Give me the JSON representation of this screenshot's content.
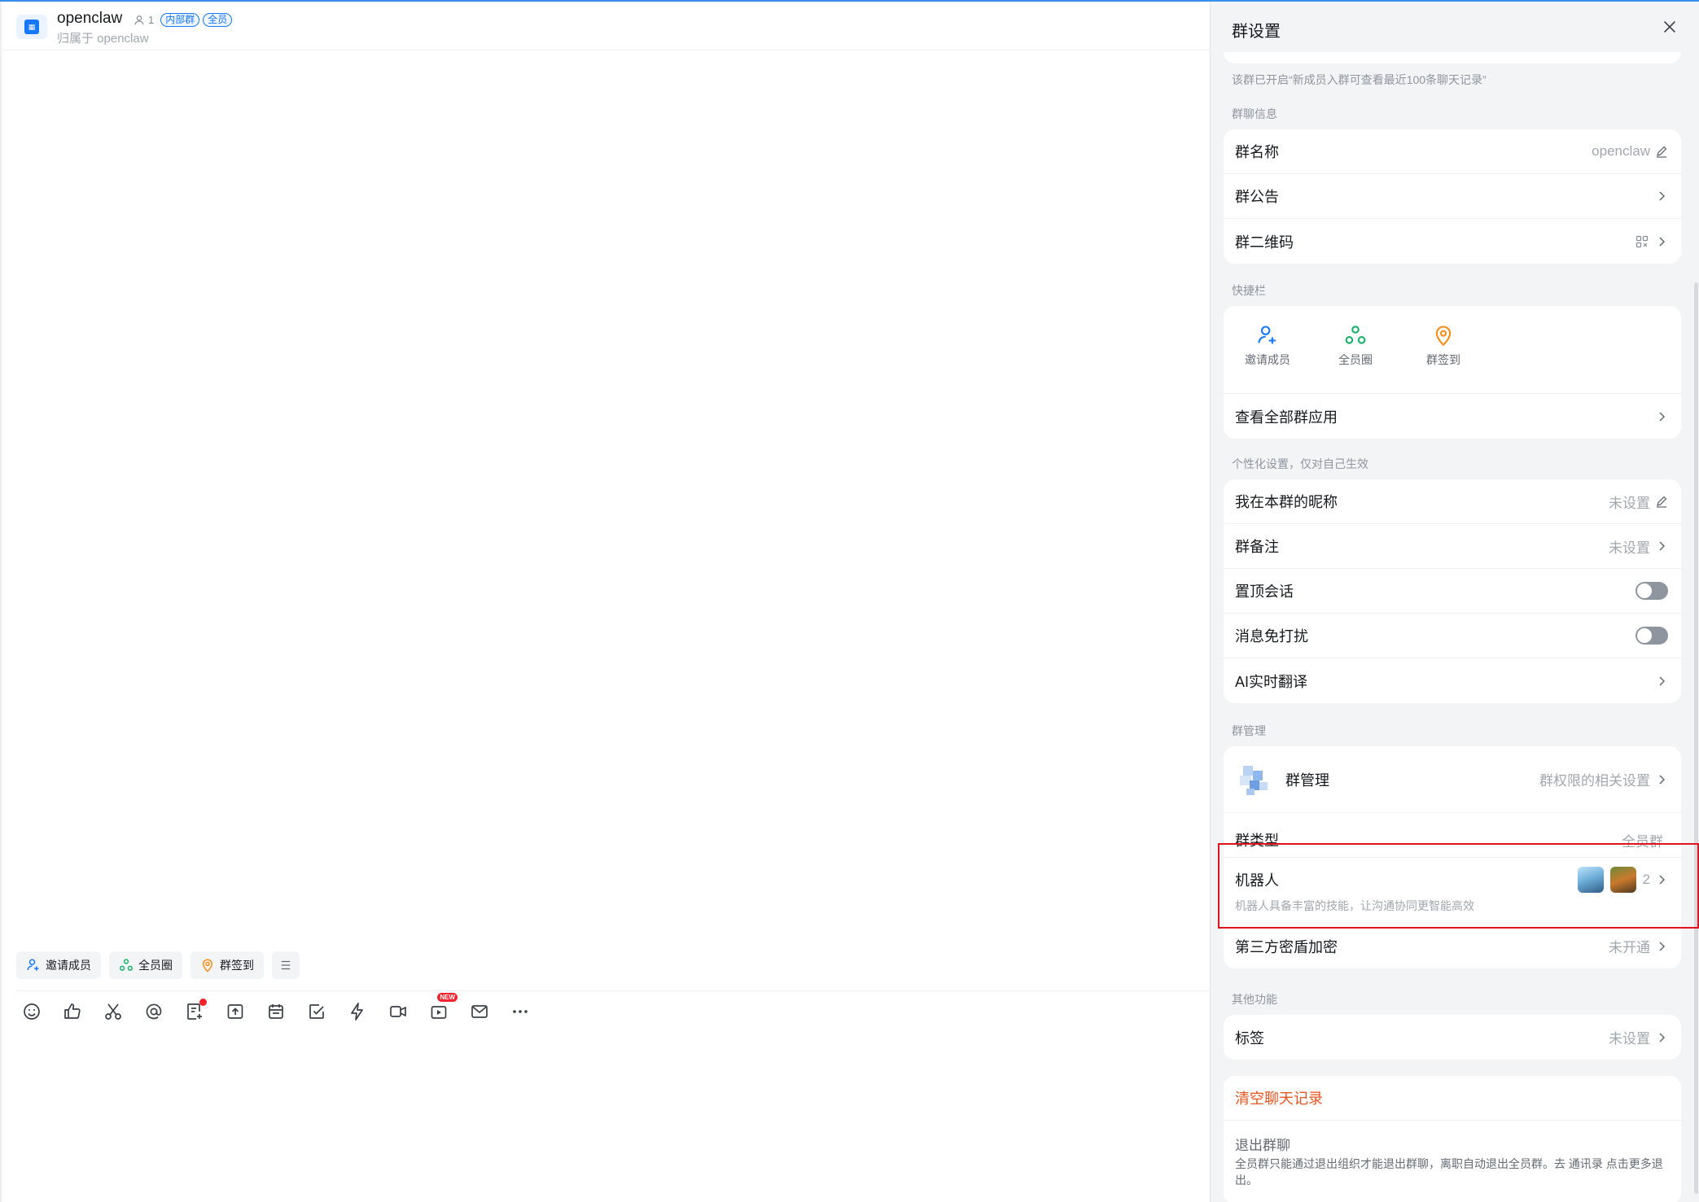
{
  "chat": {
    "title": "openclaw",
    "member_count": "1",
    "tags": [
      "内部群",
      "全员"
    ],
    "subtitle": "归属于 openclaw",
    "quick_chips": [
      {
        "label": "邀请成员",
        "icon": "user-add-icon"
      },
      {
        "label": "全员圈",
        "icon": "circle-group-icon"
      },
      {
        "label": "群签到",
        "icon": "location-checkin-icon"
      }
    ],
    "toolbar_icons": [
      "emoji-icon",
      "thumbs-up-icon",
      "scissors-icon",
      "at-icon",
      "notes-icon",
      "upload-icon",
      "calendar-icon",
      "task-check-icon",
      "lightning-icon",
      "video-call-icon",
      "live-icon",
      "mail-icon",
      "more-icon"
    ],
    "new_badge": "NEW"
  },
  "panel": {
    "title": "群设置",
    "history_note": "该群已开启“新成员入群可查看最近100条聊天记录”",
    "group_info": {
      "label": "群聊信息",
      "name_label": "群名称",
      "name_value": "openclaw",
      "notice_label": "群公告",
      "qr_label": "群二维码"
    },
    "quickbar": {
      "label": "快捷栏",
      "apps": [
        {
          "label": "邀请成员",
          "icon": "user-add-icon",
          "color": "#1677ff"
        },
        {
          "label": "全员圈",
          "icon": "circle-group-icon",
          "color": "#17b26a"
        },
        {
          "label": "群签到",
          "icon": "location-checkin-icon",
          "color": "#fa8c16"
        }
      ],
      "view_all_label": "查看全部群应用"
    },
    "personal": {
      "label": "个性化设置，仅对自己生效",
      "nickname_label": "我在本群的昵称",
      "nickname_value": "未设置",
      "remark_label": "群备注",
      "remark_value": "未设置",
      "pin_label": "置顶会话",
      "pin_on": false,
      "mute_label": "消息免打扰",
      "mute_on": false,
      "translate_label": "AI实时翻译"
    },
    "management": {
      "label": "群管理",
      "admin_label": "群管理",
      "admin_value": "群权限的相关设置",
      "type_label": "群类型",
      "type_value": "全员群",
      "robot_label": "机器人",
      "robot_desc": "机器人具备丰富的技能，让沟通协同更智能高效",
      "robot_count": "2",
      "encrypt_label": "第三方密盾加密",
      "encrypt_value": "未开通"
    },
    "other": {
      "label": "其他功能",
      "tag_label": "标签",
      "tag_value": "未设置"
    },
    "danger": {
      "clear_label": "清空聊天记录",
      "exit_label": "退出群聊",
      "exit_desc": "全员群只能通过退出组织才能退出群聊，离职自动退出全员群。去 通讯录 点击更多退出。"
    }
  },
  "colors": {
    "accent": "#1677ff",
    "danger": "#e8541d",
    "highlight": "#e0141e"
  }
}
